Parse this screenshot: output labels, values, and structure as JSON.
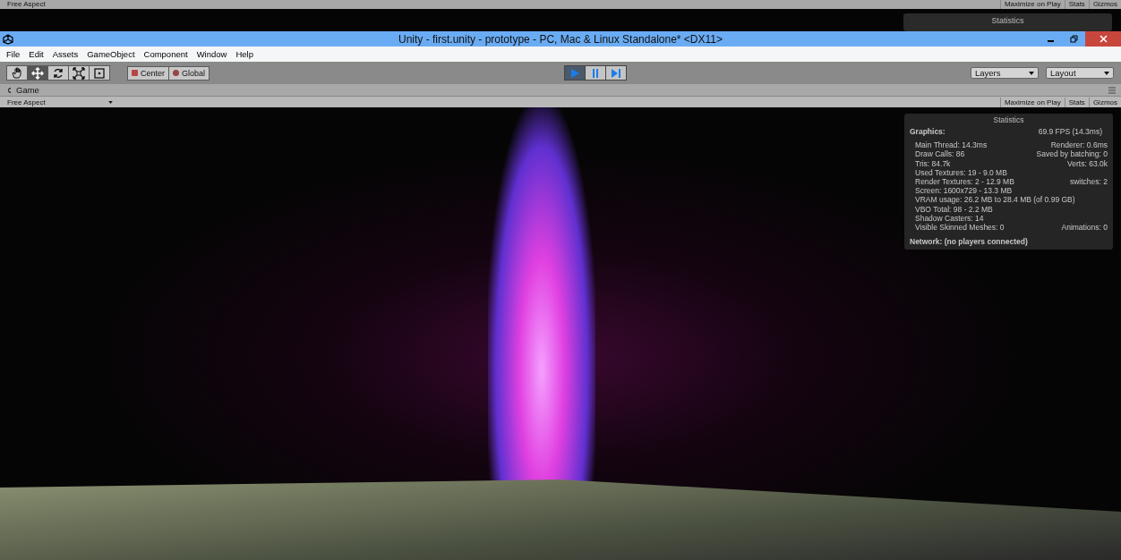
{
  "background_window": {
    "aspect": "Free Aspect",
    "buttons": [
      {
        "label": "Maximize on Play"
      },
      {
        "label": "Stats"
      },
      {
        "label": "Gizmos"
      }
    ],
    "stats_title": "Statistics"
  },
  "window": {
    "title": "Unity - first.unity - prototype - PC, Mac & Linux Standalone* <DX11>"
  },
  "menu": [
    "File",
    "Edit",
    "Assets",
    "GameObject",
    "Component",
    "Window",
    "Help"
  ],
  "tools": [
    {
      "kind": "hand",
      "selected": false
    },
    {
      "kind": "move",
      "selected": true
    },
    {
      "kind": "rotate",
      "selected": false
    },
    {
      "kind": "scale",
      "selected": false
    },
    {
      "kind": "rect",
      "selected": false
    }
  ],
  "pivot": [
    {
      "label": "Center"
    },
    {
      "label": "Global"
    }
  ],
  "playback": [
    {
      "kind": "play",
      "on": true
    },
    {
      "kind": "pause",
      "on": false
    },
    {
      "kind": "step",
      "on": false
    }
  ],
  "dropdowns": [
    {
      "label": "Layers"
    },
    {
      "label": "Layout"
    }
  ],
  "game_tab": {
    "label": "Game"
  },
  "game_toolbar": {
    "aspect": "Free Aspect",
    "buttons": [
      {
        "label": "Maximize on Play"
      },
      {
        "label": "Stats"
      },
      {
        "label": "Gizmos"
      }
    ]
  },
  "statistics": {
    "title": "Statistics",
    "graphics_label": "Graphics:",
    "fps": "69.9 FPS (14.3ms)",
    "rows": [
      {
        "left": "Main Thread: 14.3ms",
        "right": "Renderer: 0.6ms"
      },
      {
        "left": "Draw Calls: 86",
        "right": "Saved by batching: 0"
      },
      {
        "left": "Tris: 84.7k",
        "right": "Verts: 63.0k"
      },
      {
        "left": "Used Textures: 19 - 9.0 MB"
      },
      {
        "left": "Render Textures: 2 - 12.9 MB",
        "right": "switches: 2"
      },
      {
        "left": "Screen: 1600x729 - 13.3 MB"
      },
      {
        "left": "VRAM usage: 26.2 MB to 28.4 MB (of 0.99 GB)"
      },
      {
        "left": "VBO Total: 98 - 2.2 MB"
      },
      {
        "left": "Shadow Casters: 14"
      },
      {
        "left": "Visible Skinned Meshes: 0",
        "right": "Animations: 0"
      }
    ],
    "network": "Network: (no players connected)"
  }
}
